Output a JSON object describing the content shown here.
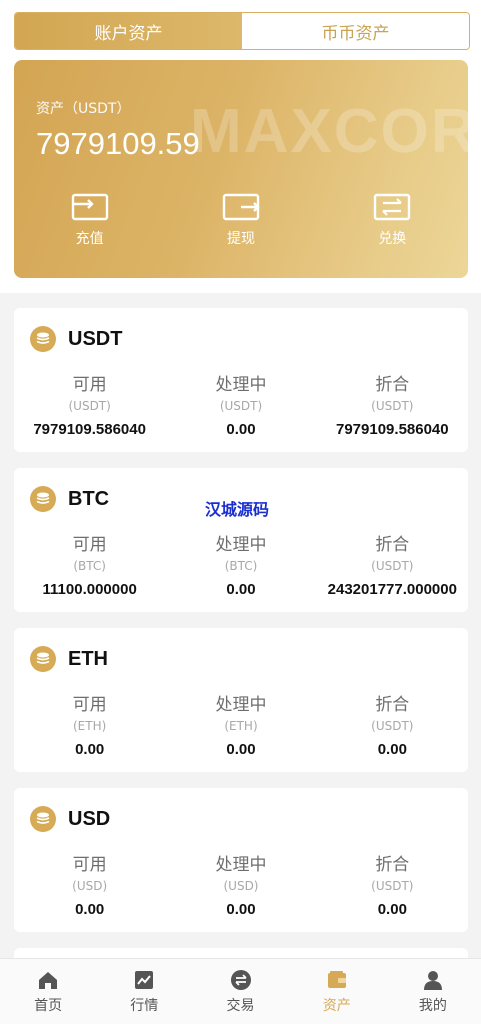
{
  "tabs": [
    {
      "label": "账户资产",
      "active": true
    },
    {
      "label": "币币资产",
      "active": false
    }
  ],
  "asset_card": {
    "label": "资产（USDT）",
    "value": "7979109.59",
    "watermark": "MAXCOR",
    "actions": [
      {
        "label": "充值",
        "icon": "deposit-icon"
      },
      {
        "label": "提现",
        "icon": "withdraw-icon"
      },
      {
        "label": "兑换",
        "icon": "exchange-icon"
      }
    ]
  },
  "coins": [
    {
      "name": "USDT",
      "available": {
        "title": "可用",
        "unit": "(USDT)",
        "value": "7979109.586040"
      },
      "processing": {
        "title": "处理中",
        "unit": "(USDT)",
        "value": "0.00"
      },
      "converted": {
        "title": "折合",
        "unit": "(USDT)",
        "value": "7979109.586040"
      }
    },
    {
      "name": "BTC",
      "available": {
        "title": "可用",
        "unit": "(BTC)",
        "value": "11100.000000"
      },
      "processing": {
        "title": "处理中",
        "unit": "(BTC)",
        "value": "0.00"
      },
      "converted": {
        "title": "折合",
        "unit": "(USDT)",
        "value": "243201777.000000"
      }
    },
    {
      "name": "ETH",
      "available": {
        "title": "可用",
        "unit": "(ETH)",
        "value": "0.00"
      },
      "processing": {
        "title": "处理中",
        "unit": "(ETH)",
        "value": "0.00"
      },
      "converted": {
        "title": "折合",
        "unit": "(USDT)",
        "value": "0.00"
      }
    },
    {
      "name": "USD",
      "available": {
        "title": "可用",
        "unit": "(USD)",
        "value": "0.00"
      },
      "processing": {
        "title": "处理中",
        "unit": "(USD)",
        "value": "0.00"
      },
      "converted": {
        "title": "折合",
        "unit": "(USDT)",
        "value": "0.00"
      }
    }
  ],
  "overlay_text": "汉城源码",
  "nav": [
    {
      "label": "首页",
      "icon": "home-icon",
      "active": false
    },
    {
      "label": "行情",
      "icon": "chart-icon",
      "active": false
    },
    {
      "label": "交易",
      "icon": "trade-icon",
      "active": false
    },
    {
      "label": "资产",
      "icon": "wallet-icon",
      "active": true
    },
    {
      "label": "我的",
      "icon": "user-icon",
      "active": false
    }
  ],
  "colors": {
    "accent": "#d6a957",
    "nav_inactive": "#555555"
  }
}
